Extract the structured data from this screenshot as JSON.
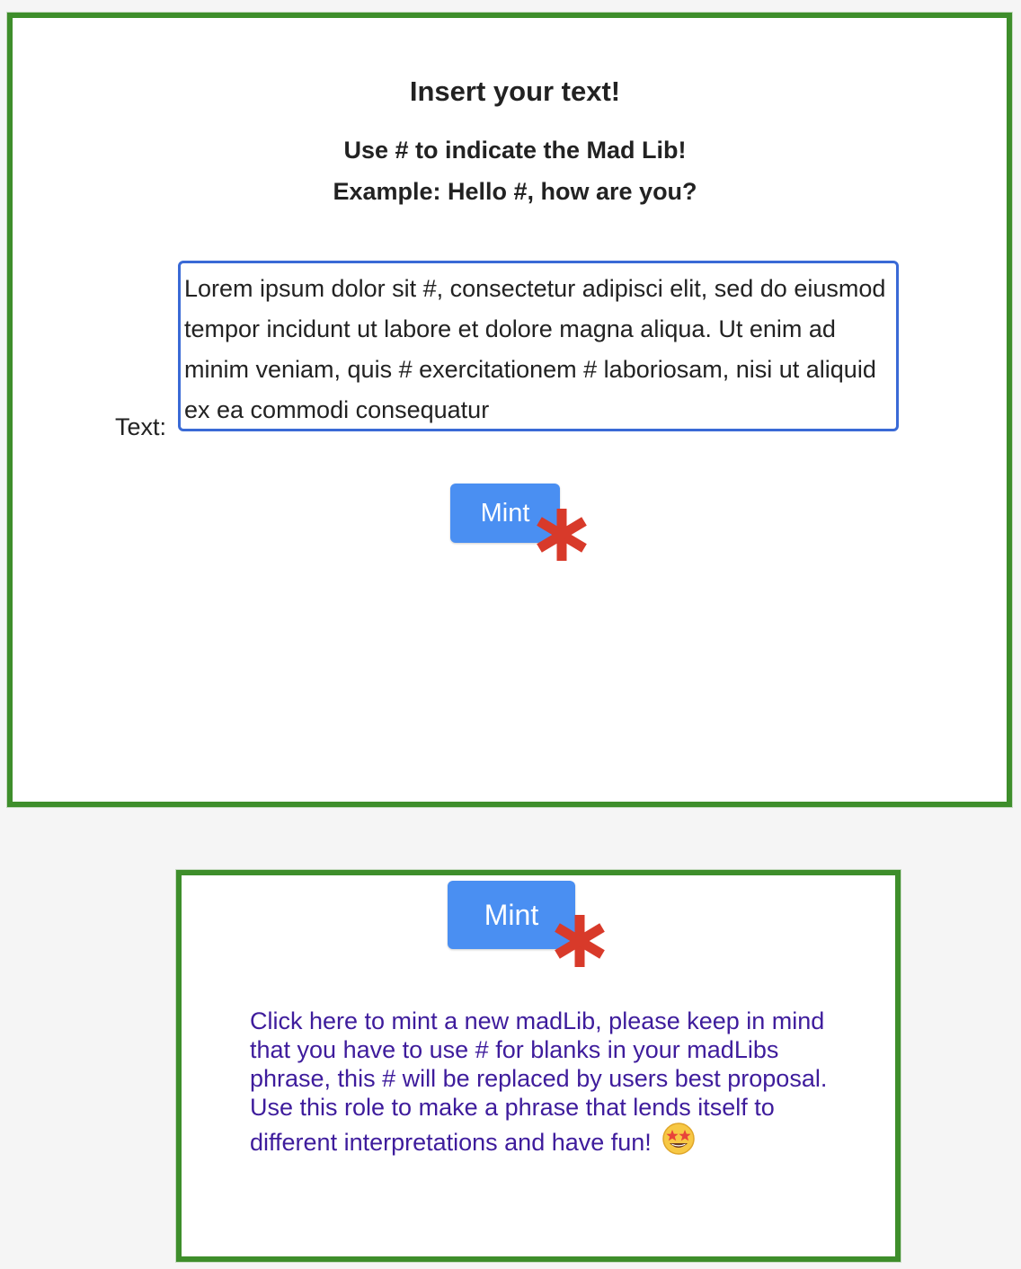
{
  "editor": {
    "title": "Insert your text!",
    "instruction": "Use # to indicate the Mad Lib!",
    "example": "Example: Hello #, how are you?",
    "text_label": "Text:",
    "text_value": "Lorem ipsum dolor sit #, consectetur adipisci elit, sed do eiusmod tempor incidunt ut labore et dolore magna aliqua. Ut enim ad minim veniam, quis # exercitationem # laboriosam, nisi ut aliquid ex ea commodi consequatur",
    "mint_label": "Mint"
  },
  "tooltip": {
    "mint_label": "Mint",
    "help_text": "Click here to mint a new madLib, please keep in mind that you have to use # for blanks in your madLibs phrase, this # will be replaced by users best proposal. Use this role to make a phrase that lends itself to different interpretations and have fun!",
    "emoji": "star-struck-emoji-icon"
  },
  "colors": {
    "frame_border": "#3e8e2b",
    "button_bg": "#4a8ff2",
    "asterisk": "#d83a2a",
    "help_text": "#3e1c9c",
    "textarea_border": "#3a6ad6"
  }
}
